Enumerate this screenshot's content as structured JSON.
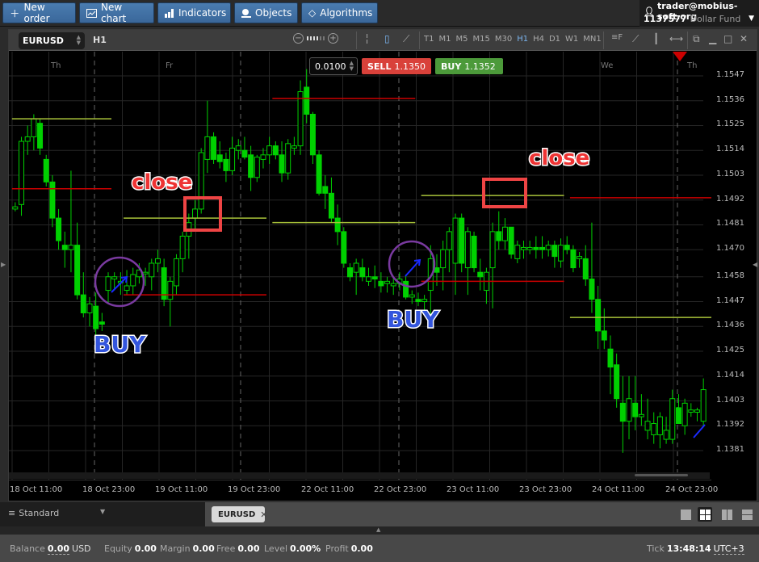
{
  "toolbar": {
    "buttons": [
      {
        "label": "New order",
        "icon": "plus-icon"
      },
      {
        "label": "New chart",
        "icon": "chart-icon"
      },
      {
        "label": "Indicators",
        "icon": "bar-chart-icon"
      },
      {
        "label": "Objects",
        "icon": "objects-icon"
      },
      {
        "label": "Algorithms",
        "icon": "diamond-icon"
      }
    ]
  },
  "account": {
    "user": "trader@mobius-soft.org",
    "number": "1137577",
    "fund": "Dollar Fund"
  },
  "chart_window": {
    "symbol": "EURUSD",
    "timeframe": "H1",
    "timeframes": [
      "T1",
      "M1",
      "M5",
      "M15",
      "M30",
      "H1",
      "H4",
      "D1",
      "W1",
      "MN1"
    ],
    "active_timeframe": "H1",
    "lot": "0.0100",
    "sell_label": "SELL",
    "sell_price": "1.1350",
    "buy_label": "BUY",
    "buy_price": "1.1352",
    "colors": {
      "sell": "#d9413a",
      "buy": "#4c9a3a",
      "candle": "#00d100",
      "support": "#a8c23a",
      "resistance": "#cc0000"
    }
  },
  "chart_data": {
    "type": "candlestick",
    "symbol": "EURUSD",
    "timeframe": "H1",
    "y_ticks": [
      "1.1547",
      "1.1536",
      "1.1525",
      "1.1514",
      "1.1503",
      "1.1492",
      "1.1481",
      "1.1470",
      "1.1458",
      "1.1447",
      "1.1436",
      "1.1425",
      "1.1414",
      "1.1403",
      "1.1392",
      "1.1381"
    ],
    "ylim": [
      1.1371,
      1.1557
    ],
    "x_ticks": [
      "18 Oct 11:00",
      "18 Oct 23:00",
      "19 Oct 11:00",
      "19 Oct 23:00",
      "22 Oct 11:00",
      "22 Oct 23:00",
      "23 Oct 11:00",
      "23 Oct 23:00",
      "24 Oct 11:00",
      "24 Oct 23:00"
    ],
    "day_labels": [
      "Th",
      "Fr",
      "We",
      "Th"
    ],
    "grid": true,
    "candles": [
      [
        1.1488,
        1.1491,
        1.1487,
        1.1489
      ],
      [
        1.149,
        1.152,
        1.1485,
        1.1518
      ],
      [
        1.1518,
        1.1525,
        1.1512,
        1.152
      ],
      [
        1.152,
        1.153,
        1.1514,
        1.1528
      ],
      [
        1.1526,
        1.1528,
        1.1512,
        1.1515
      ],
      [
        1.151,
        1.1512,
        1.1498,
        1.15
      ],
      [
        1.15,
        1.1503,
        1.148,
        1.1484
      ],
      [
        1.1484,
        1.1488,
        1.147,
        1.1474
      ],
      [
        1.1472,
        1.1478,
        1.1462,
        1.147
      ],
      [
        1.147,
        1.1505,
        1.146,
        1.1472
      ],
      [
        1.1472,
        1.1482,
        1.1448,
        1.145
      ],
      [
        1.145,
        1.146,
        1.144,
        1.1442
      ],
      [
        1.1442,
        1.1449,
        1.1436,
        1.1446
      ],
      [
        1.1445,
        1.1451,
        1.1432,
        1.1435
      ],
      [
        1.1438,
        1.1442,
        1.1434,
        1.1437
      ],
      [
        1.1452,
        1.146,
        1.1446,
        1.1458
      ],
      [
        1.1457,
        1.146,
        1.1452,
        1.1458
      ],
      [
        1.1456,
        1.146,
        1.145,
        1.1456
      ],
      [
        1.1452,
        1.1461,
        1.145,
        1.1454
      ],
      [
        1.1454,
        1.1462,
        1.145,
        1.1459
      ],
      [
        1.1458,
        1.1464,
        1.1455,
        1.1461
      ],
      [
        1.146,
        1.1462,
        1.1454,
        1.146
      ],
      [
        1.1458,
        1.1466,
        1.1452,
        1.1464
      ],
      [
        1.1464,
        1.147,
        1.146,
        1.1466
      ],
      [
        1.1462,
        1.1466,
        1.1445,
        1.1448
      ],
      [
        1.1448,
        1.1458,
        1.1436,
        1.1456
      ],
      [
        1.1454,
        1.1468,
        1.145,
        1.1466
      ],
      [
        1.1466,
        1.1478,
        1.146,
        1.1476
      ],
      [
        1.1476,
        1.1486,
        1.1466,
        1.1482
      ],
      [
        1.1484,
        1.1492,
        1.1478,
        1.1488
      ],
      [
        1.1488,
        1.1515,
        1.1486,
        1.1513
      ],
      [
        1.151,
        1.1536,
        1.1504,
        1.152
      ],
      [
        1.152,
        1.1522,
        1.1508,
        1.151
      ],
      [
        1.1512,
        1.1518,
        1.1506,
        1.1509
      ],
      [
        1.151,
        1.1513,
        1.15,
        1.1505
      ],
      [
        1.1505,
        1.152,
        1.1503,
        1.1515
      ],
      [
        1.1514,
        1.1519,
        1.151,
        1.1516
      ],
      [
        1.1514,
        1.152,
        1.151,
        1.1511
      ],
      [
        1.1512,
        1.1516,
        1.1496,
        1.1502
      ],
      [
        1.1502,
        1.1512,
        1.15,
        1.1511
      ],
      [
        1.151,
        1.1515,
        1.1506,
        1.1512
      ],
      [
        1.1512,
        1.152,
        1.1508,
        1.1516
      ],
      [
        1.1516,
        1.1518,
        1.151,
        1.1512
      ],
      [
        1.1512,
        1.1518,
        1.15,
        1.1504
      ],
      [
        1.1504,
        1.1519,
        1.1501,
        1.1517
      ],
      [
        1.1515,
        1.152,
        1.1512,
        1.1516
      ],
      [
        1.1516,
        1.1545,
        1.1512,
        1.154
      ],
      [
        1.1542,
        1.155,
        1.1526,
        1.153
      ],
      [
        1.153,
        1.1531,
        1.1508,
        1.1512
      ],
      [
        1.1512,
        1.1514,
        1.1494,
        1.1495
      ],
      [
        1.1498,
        1.1503,
        1.1488,
        1.1495
      ],
      [
        1.1495,
        1.1502,
        1.1482,
        1.1484
      ],
      [
        1.1484,
        1.149,
        1.1472,
        1.1478
      ],
      [
        1.1478,
        1.148,
        1.1462,
        1.1464
      ],
      [
        1.1462,
        1.1464,
        1.1456,
        1.1458
      ],
      [
        1.146,
        1.1466,
        1.145,
        1.1464
      ],
      [
        1.1462,
        1.1466,
        1.1456,
        1.1458
      ],
      [
        1.1456,
        1.1462,
        1.1454,
        1.1458
      ],
      [
        1.1458,
        1.1463,
        1.1453,
        1.1457
      ],
      [
        1.1456,
        1.146,
        1.1451,
        1.1454
      ],
      [
        1.1455,
        1.1458,
        1.1451,
        1.1456
      ],
      [
        1.1454,
        1.1458,
        1.145,
        1.1455
      ],
      [
        1.1455,
        1.146,
        1.1452,
        1.1457
      ],
      [
        1.1456,
        1.1459,
        1.1448,
        1.1449
      ],
      [
        1.1449,
        1.1452,
        1.1446,
        1.145
      ],
      [
        1.1448,
        1.1451,
        1.1445,
        1.1447
      ],
      [
        1.1447,
        1.145,
        1.1443,
        1.1448
      ],
      [
        1.1452,
        1.1472,
        1.1436,
        1.1466
      ],
      [
        1.1462,
        1.1468,
        1.1454,
        1.146
      ],
      [
        1.1462,
        1.1474,
        1.1452,
        1.147
      ],
      [
        1.147,
        1.148,
        1.146,
        1.1478
      ],
      [
        1.1464,
        1.1486,
        1.145,
        1.1484
      ],
      [
        1.1484,
        1.1486,
        1.146,
        1.1464
      ],
      [
        1.1462,
        1.148,
        1.145,
        1.1478
      ],
      [
        1.1476,
        1.1478,
        1.146,
        1.1462
      ],
      [
        1.146,
        1.1466,
        1.1452,
        1.1458
      ],
      [
        1.1452,
        1.1462,
        1.1446,
        1.146
      ],
      [
        1.1462,
        1.1482,
        1.1444,
        1.1478
      ],
      [
        1.1478,
        1.1487,
        1.147,
        1.1474
      ],
      [
        1.1474,
        1.1484,
        1.147,
        1.148
      ],
      [
        1.148,
        1.148,
        1.1466,
        1.1468
      ],
      [
        1.1466,
        1.1474,
        1.1464,
        1.1472
      ],
      [
        1.147,
        1.1474,
        1.1466,
        1.1471
      ],
      [
        1.147,
        1.1474,
        1.1468,
        1.1471
      ],
      [
        1.1471,
        1.1476,
        1.1466,
        1.147
      ],
      [
        1.1471,
        1.1476,
        1.1466,
        1.147
      ],
      [
        1.147,
        1.1474,
        1.1467,
        1.1472
      ],
      [
        1.1472,
        1.1474,
        1.1462,
        1.1467
      ],
      [
        1.1465,
        1.1475,
        1.1462,
        1.1472
      ],
      [
        1.1472,
        1.1476,
        1.1468,
        1.147
      ],
      [
        1.147,
        1.1472,
        1.146,
        1.1462
      ],
      [
        1.1466,
        1.1469,
        1.1462,
        1.1467
      ],
      [
        1.1466,
        1.1472,
        1.1454,
        1.1457
      ],
      [
        1.1457,
        1.1482,
        1.1442,
        1.1448
      ],
      [
        1.1448,
        1.1454,
        1.1426,
        1.1434
      ],
      [
        1.1434,
        1.1444,
        1.1426,
        1.143
      ],
      [
        1.1426,
        1.1432,
        1.1406,
        1.1418
      ],
      [
        1.1419,
        1.1424,
        1.14,
        1.1404
      ],
      [
        1.1402,
        1.1414,
        1.138,
        1.1394
      ],
      [
        1.1394,
        1.1414,
        1.1386,
        1.1404
      ],
      [
        1.1402,
        1.1414,
        1.139,
        1.1396
      ],
      [
        1.1396,
        1.1406,
        1.1392,
        1.1397
      ],
      [
        1.139,
        1.1404,
        1.1386,
        1.1394
      ],
      [
        1.1388,
        1.1398,
        1.1384,
        1.1393
      ],
      [
        1.1388,
        1.1398,
        1.1382,
        1.1396
      ],
      [
        1.1386,
        1.1396,
        1.1384,
        1.139
      ],
      [
        1.1386,
        1.1408,
        1.1384,
        1.1404
      ],
      [
        1.14,
        1.1406,
        1.1394,
        1.1393
      ],
      [
        1.1392,
        1.1404,
        1.1388,
        1.1402
      ],
      [
        1.1398,
        1.1402,
        1.1396,
        1.1399
      ],
      [
        1.1398,
        1.14,
        1.1394,
        1.1399
      ],
      [
        1.1394,
        1.1413,
        1.1392,
        1.1408
      ]
    ],
    "levels": [
      {
        "kind": "support",
        "price": 1.1528,
        "from": 0,
        "to": 15
      },
      {
        "kind": "resistance",
        "price": 1.1497,
        "from": 0,
        "to": 15
      },
      {
        "kind": "support",
        "price": 1.1484,
        "from": 18,
        "to": 40
      },
      {
        "kind": "resistance",
        "price": 1.145,
        "from": 18,
        "to": 40
      },
      {
        "kind": "resistance",
        "price": 1.1537,
        "from": 42,
        "to": 64
      },
      {
        "kind": "support",
        "price": 1.1482,
        "from": 42,
        "to": 64
      },
      {
        "kind": "support",
        "price": 1.1494,
        "from": 66,
        "to": 88
      },
      {
        "kind": "resistance",
        "price": 1.1456,
        "from": 66,
        "to": 88
      },
      {
        "kind": "resistance",
        "price": 1.1493,
        "from": 90,
        "to": 112
      },
      {
        "kind": "support",
        "price": 1.144,
        "from": 90,
        "to": 112
      }
    ],
    "annotations": [
      {
        "text": "BUY",
        "type": "label",
        "color": "#3355dd"
      },
      {
        "text": "close",
        "type": "label",
        "color": "#ee3333"
      },
      {
        "text": "BUY",
        "type": "label",
        "color": "#3355dd"
      },
      {
        "text": "close",
        "type": "label",
        "color": "#ee3333"
      }
    ]
  },
  "bottom": {
    "workspace": "Standard",
    "tabs": [
      {
        "label": "EURUSD"
      }
    ]
  },
  "status": {
    "balance_label": "Balance",
    "balance": "0.00",
    "currency": "USD",
    "equity_label": "Equity",
    "equity": "0.00",
    "margin_label": "Margin",
    "margin": "0.00",
    "free_label": "Free",
    "free": "0.00",
    "level_label": "Level",
    "level": "0.00%",
    "profit_label": "Profit",
    "profit": "0.00",
    "tick_label": "Tick",
    "tick_time": "13:48:14",
    "timezone": "UTC+3"
  }
}
